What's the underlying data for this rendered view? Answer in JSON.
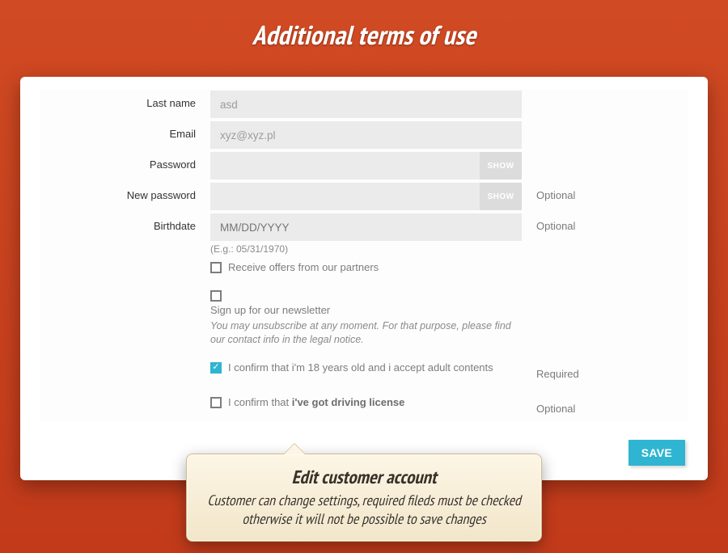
{
  "hero": {
    "title": "Additional terms of use"
  },
  "form": {
    "lastname": {
      "label": "Last name",
      "value": "asd"
    },
    "email": {
      "label": "Email",
      "value": "xyz@xyz.pl"
    },
    "password": {
      "label": "Password",
      "value": "",
      "show": "SHOW"
    },
    "newpassword": {
      "label": "New password",
      "value": "",
      "show": "SHOW",
      "optional": "Optional"
    },
    "birthdate": {
      "label": "Birthdate",
      "placeholder": "MM/DD/YYYY",
      "hint": "(E.g.: 05/31/1970)",
      "optional": "Optional"
    },
    "offers": {
      "label": "Receive offers from our partners"
    },
    "newsletter": {
      "label": "Sign up for our newsletter",
      "note": "You may unsubscribe at any moment. For that purpose, please find our contact info in the legal notice."
    },
    "adult": {
      "prefix": "I confirm that i'm 18 years old and i accept adult contents",
      "tag": "Required"
    },
    "license": {
      "prefix": "I confirm that ",
      "bold": "i've got driving license",
      "tag": "Optional"
    },
    "save": "SAVE"
  },
  "callout": {
    "title": "Edit customer account",
    "body": "Customer can change settings, required fileds must be checked otherwise it will not be possible to save changes"
  }
}
